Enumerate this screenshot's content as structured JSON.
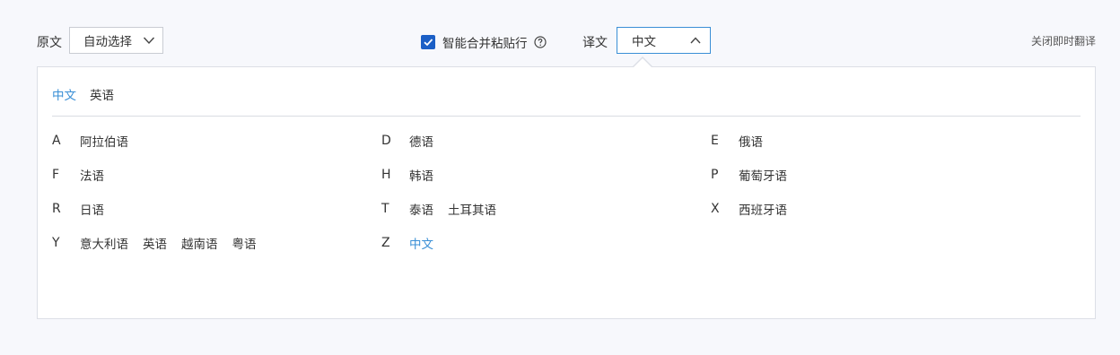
{
  "toolbar": {
    "source_label": "原文",
    "source_value": "自动选择",
    "merge_label": "智能合并粘贴行",
    "merge_checked": true,
    "target_label": "译文",
    "target_value": "中文",
    "close_instant": "关闭即时翻译"
  },
  "panel": {
    "recent": [
      "中文",
      "英语"
    ],
    "recent_active": "中文",
    "groups": [
      {
        "letter": "A",
        "langs": [
          "阿拉伯语"
        ]
      },
      {
        "letter": "D",
        "langs": [
          "德语"
        ]
      },
      {
        "letter": "E",
        "langs": [
          "俄语"
        ]
      },
      {
        "letter": "F",
        "langs": [
          "法语"
        ]
      },
      {
        "letter": "H",
        "langs": [
          "韩语"
        ]
      },
      {
        "letter": "P",
        "langs": [
          "葡萄牙语"
        ]
      },
      {
        "letter": "R",
        "langs": [
          "日语"
        ]
      },
      {
        "letter": "T",
        "langs": [
          "泰语",
          "土耳其语"
        ]
      },
      {
        "letter": "X",
        "langs": [
          "西班牙语"
        ]
      },
      {
        "letter": "Y",
        "langs": [
          "意大利语",
          "英语",
          "越南语",
          "粤语"
        ]
      },
      {
        "letter": "Z",
        "langs": [
          "中文"
        ]
      }
    ],
    "selected": "中文"
  },
  "colors": {
    "accent": "#3a8fd6",
    "checkbox": "#1b5fc6",
    "background": "#f7f8fc"
  },
  "icons": {
    "source_chevron": "chevron-down-icon",
    "target_chevron": "chevron-up-icon",
    "help": "question-circle-icon",
    "check": "check-icon"
  }
}
